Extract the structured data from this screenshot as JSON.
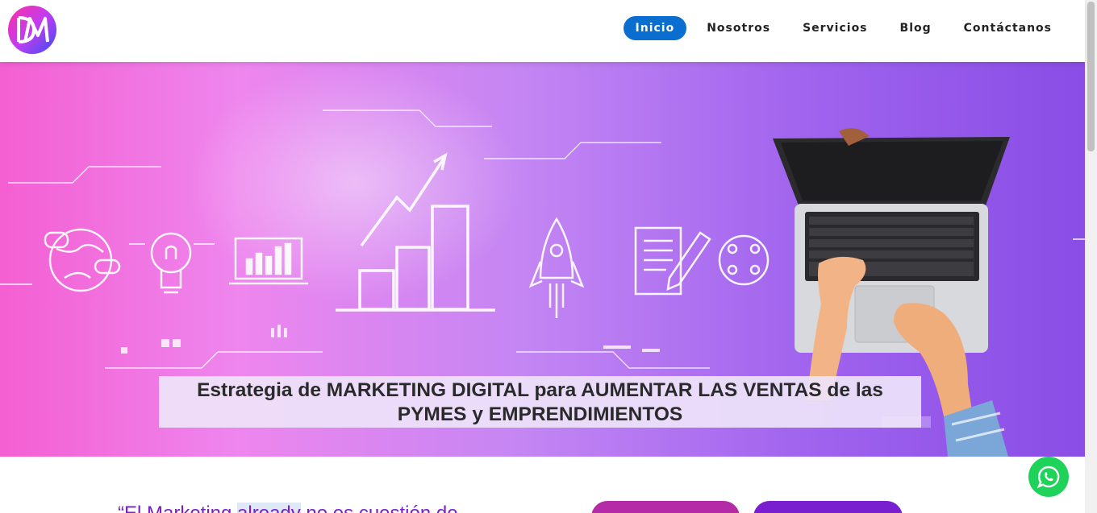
{
  "header": {
    "logo_text": "DM",
    "nav": [
      {
        "label": "Inicio",
        "active": true
      },
      {
        "label": "Nosotros",
        "active": false
      },
      {
        "label": "Servicios",
        "active": false
      },
      {
        "label": "Blog",
        "active": false
      },
      {
        "label": "Contáctanos",
        "active": false
      }
    ]
  },
  "hero": {
    "caption_line1": "Estrategia de MARKETING DIGITAL para AUMENTAR LAS VENTAS de las",
    "caption_line2": "PYMES y EMPRENDIMIENTOS"
  },
  "content": {
    "quote_start": "“El Marketing ",
    "quote_highlight": "already",
    "quote_end": " no es cuestión de"
  },
  "colors": {
    "nav_active": "#0a6ed1",
    "quote": "#7b1fc9",
    "cta_primary": "#b52aa6",
    "cta_secondary": "#7a1fd0",
    "whatsapp": "#1fd35a"
  },
  "icons": [
    "logo-icon",
    "whatsapp-icon"
  ]
}
